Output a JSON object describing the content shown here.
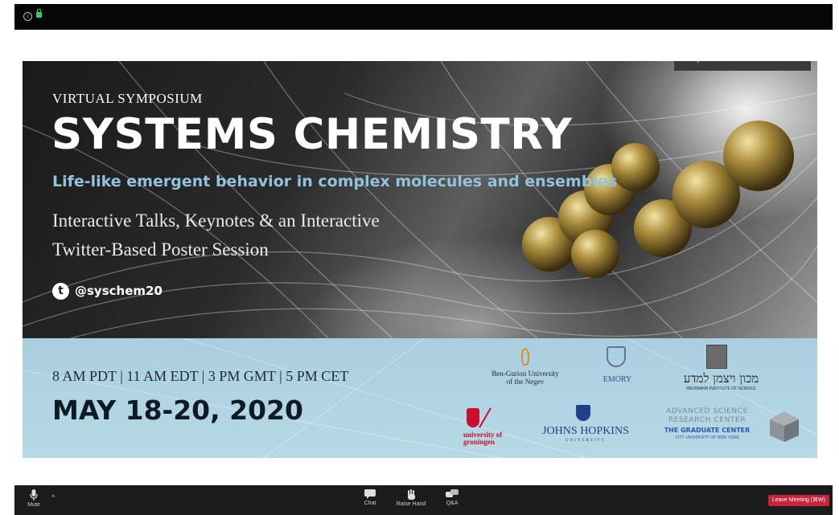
{
  "slide": {
    "talking_indicator": "Talking: Jasmine Sabio",
    "eyebrow": "VIRTUAL SYMPOSIUM",
    "title": "SYSTEMS CHEMISTRY",
    "subtitle": "Life-like emergent behavior in complex molecules and ensembles",
    "description_line1": "Interactive Talks, Keynotes & an Interactive",
    "description_line2": "Twitter-Based Poster Session",
    "twitter_icon_glyph": "t",
    "twitter_handle": "@syschem20",
    "times": "8 AM PDT | 11 AM EDT | 3 PM GMT | 5 PM CET",
    "dates": "MAY 18-20, 2020"
  },
  "logos": {
    "bgu_line1": "Ben-Gurion University",
    "bgu_line2": "of the Negev",
    "emory": "EMORY",
    "weizmann_hebrew": "מכון ויצמן למדע",
    "weizmann_english": "WEIZMANN INSTITUTE OF SCIENCE",
    "groningen_line1": "university of",
    "groningen_line2": "groningen",
    "jhu": "JOHNS HOPKINS",
    "jhu_sub": "UNIVERSITY",
    "asrc_line1": "ADVANCED SCIENCE",
    "asrc_line2": "RESEARCH CENTER",
    "gc": "THE GRADUATE CENTER",
    "cuny": "CITY UNIVERSITY OF NEW YORK"
  },
  "toolbar": {
    "mute_label": "Mute",
    "chat_label": "Chat",
    "raise_hand_label": "Raise Hand",
    "qa_label": "Q&A",
    "leave_label": "Leave Meeting (⌘W)"
  },
  "colors": {
    "subtitle_accent": "#8ec4dc",
    "leave_button": "#c7253a",
    "secure_lock": "#2fd24a"
  }
}
